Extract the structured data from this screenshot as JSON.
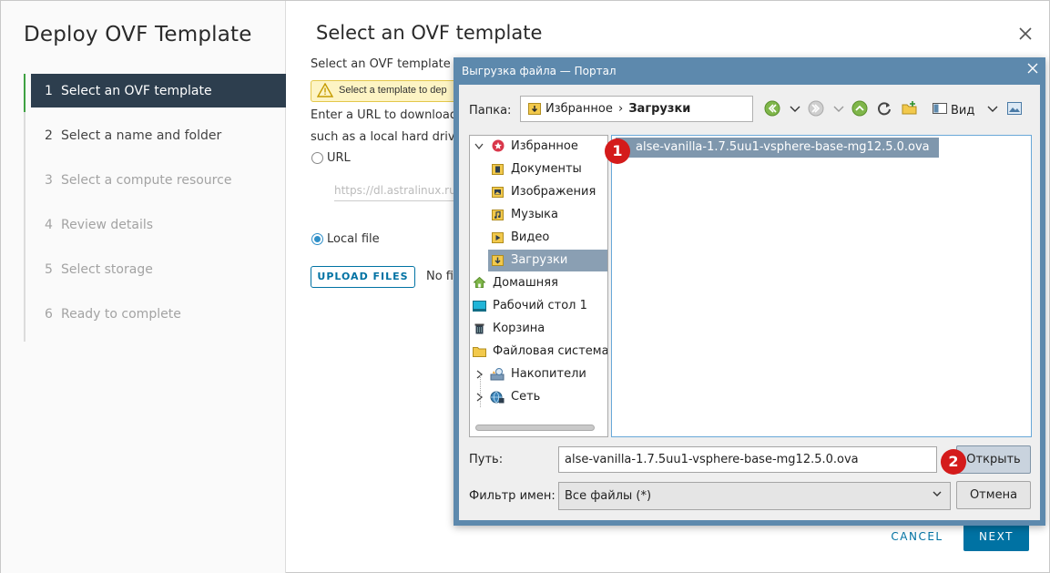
{
  "wizard": {
    "title": "Deploy OVF Template",
    "steps": [
      {
        "num": "1",
        "label": "Select an OVF template",
        "state": "active"
      },
      {
        "num": "2",
        "label": "Select a name and folder",
        "state": "enabled"
      },
      {
        "num": "3",
        "label": "Select a compute resource",
        "state": "disabled"
      },
      {
        "num": "4",
        "label": "Review details",
        "state": "disabled"
      },
      {
        "num": "5",
        "label": "Select storage",
        "state": "disabled"
      },
      {
        "num": "6",
        "label": "Ready to complete",
        "state": "disabled"
      }
    ],
    "page_title": "Select an OVF template",
    "intro_text": "Select an OVF template f",
    "alert_text": "Select a template to dep",
    "url_text_line1": "Enter a URL to download",
    "url_text_line2": "such as a local hard drive,",
    "radio_url_label": "URL",
    "url_placeholder": "https://dl.astralinux.ru",
    "radio_local_label": "Local file",
    "upload_button": "UPLOAD FILES",
    "no_file_text": "No fil",
    "cancel_button": "CANCEL",
    "next_button": "NEXT",
    "colors": {
      "active_step_bg": "#2d3e4e",
      "accent": "#0072a3",
      "step_marker": "#3fa142"
    }
  },
  "dialog": {
    "title": "Выгрузка файла — Портал",
    "folder_label": "Папка:",
    "breadcrumb": {
      "parent": "Избранное",
      "current": "Загрузки"
    },
    "view_label": "Вид",
    "tree": [
      {
        "label": "Избранное",
        "icon": "favorites-icon",
        "expand": "open",
        "level": 0
      },
      {
        "label": "Документы",
        "icon": "documents-folder-icon",
        "level": 1
      },
      {
        "label": "Изображения",
        "icon": "images-folder-icon",
        "level": 1
      },
      {
        "label": "Музыка",
        "icon": "music-folder-icon",
        "level": 1
      },
      {
        "label": "Видео",
        "icon": "video-folder-icon",
        "level": 1
      },
      {
        "label": "Загрузки",
        "icon": "downloads-folder-icon",
        "level": 1,
        "selected": true
      },
      {
        "label": "Домашняя",
        "icon": "home-icon",
        "level": 0
      },
      {
        "label": "Рабочий стол 1",
        "icon": "desktop-icon",
        "level": 0
      },
      {
        "label": "Корзина",
        "icon": "trash-icon",
        "level": 0
      },
      {
        "label": "Файловая система",
        "icon": "filesystem-folder-icon",
        "level": 0
      },
      {
        "label": "Накопители",
        "icon": "drives-icon",
        "expand": "closed",
        "level": 0
      },
      {
        "label": "Сеть",
        "icon": "network-icon",
        "expand": "closed",
        "level": 0
      }
    ],
    "files": [
      {
        "name": "alse-vanilla-1.7.5uu1-vsphere-base-mg12.5.0.ova",
        "selected": true
      }
    ],
    "path_label": "Путь:",
    "path_value": "alse-vanilla-1.7.5uu1-vsphere-base-mg12.5.0.ova",
    "open_button": "Открыть",
    "filter_label": "Фильтр имен:",
    "filter_value": "Все файлы (*)",
    "cancel_button": "Отмена",
    "colors": {
      "titlebar": "#5d89ad",
      "selection": "#7f97ad"
    }
  },
  "annotations": {
    "badge1": "1",
    "badge2": "2",
    "color": "#d41b1b"
  }
}
